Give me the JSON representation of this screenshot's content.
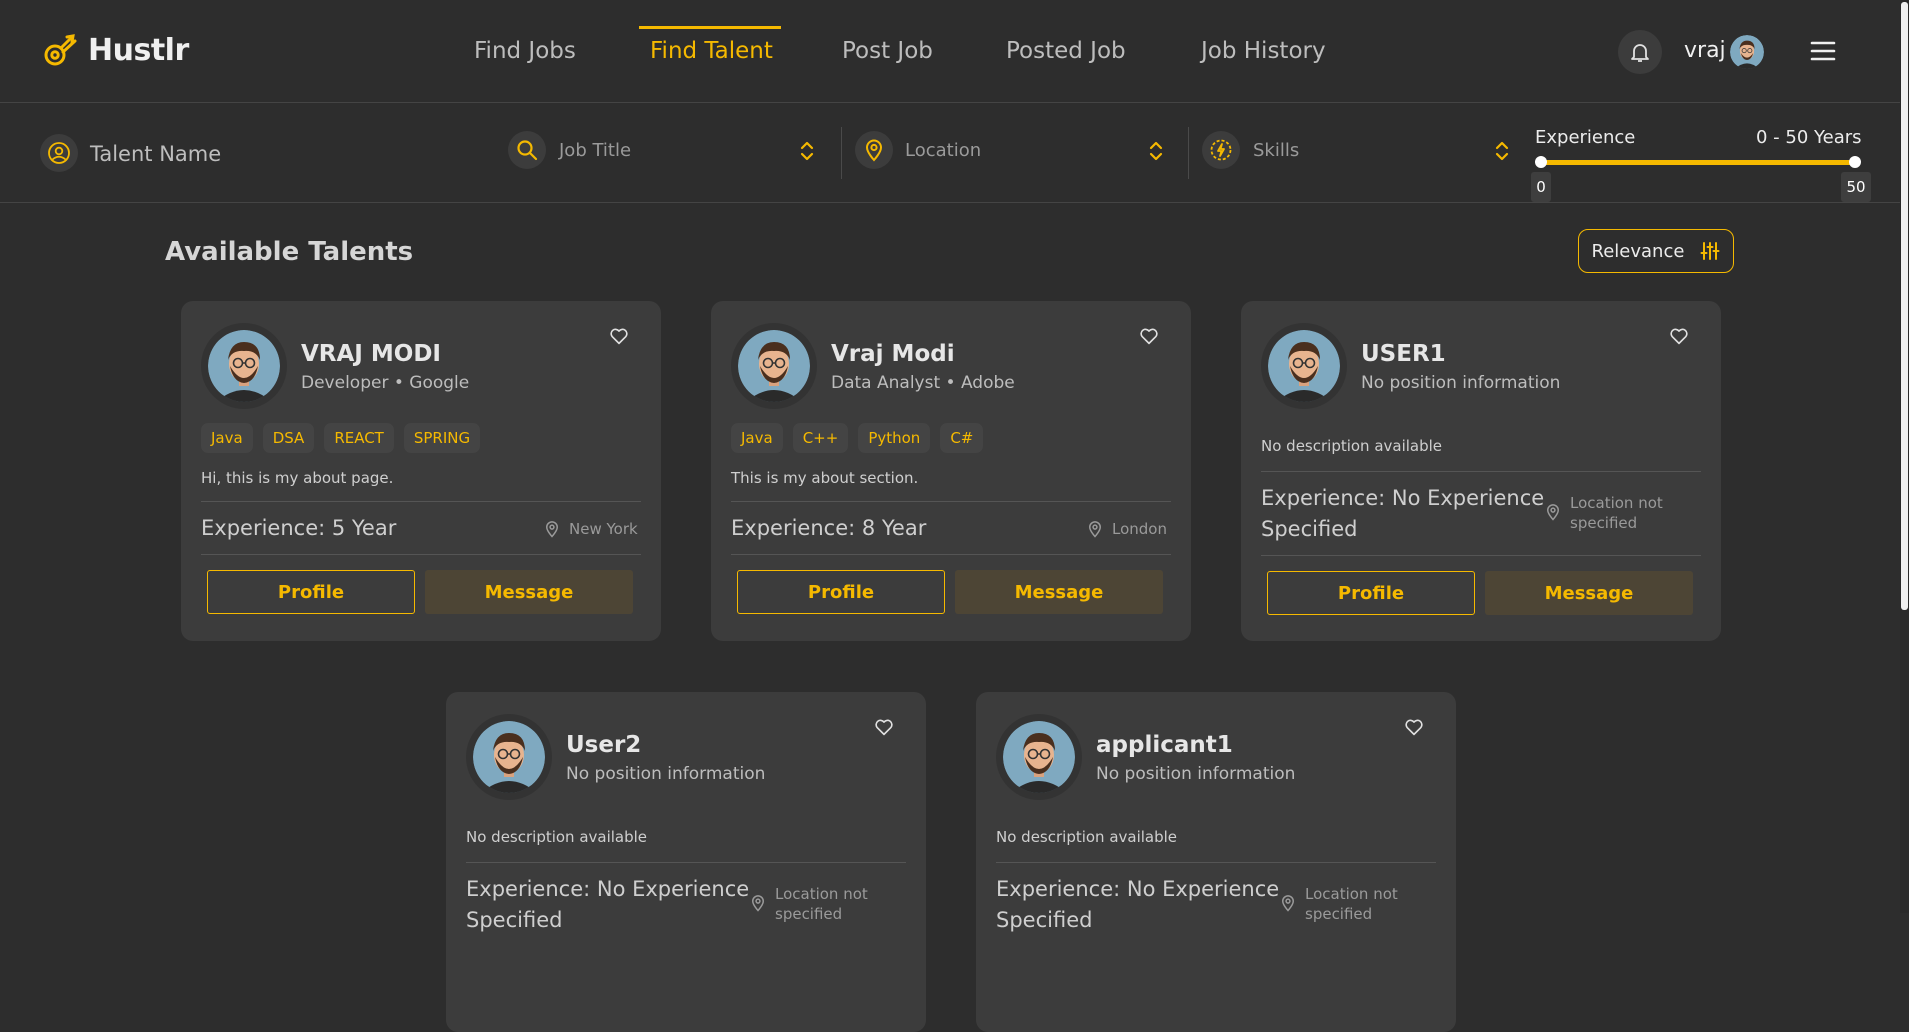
{
  "app": {
    "name": "Hustlr"
  },
  "nav": [
    {
      "label": "Find Jobs"
    },
    {
      "label": "Find Talent",
      "active": true
    },
    {
      "label": "Post Job"
    },
    {
      "label": "Posted Job"
    },
    {
      "label": "Job History"
    }
  ],
  "user": {
    "name": "vraj"
  },
  "filters": {
    "talent_name": "Talent Name",
    "job_title": "Job Title",
    "location": "Location",
    "skills": "Skills",
    "experience": {
      "label": "Experience",
      "range_text": "0 - 50 Years",
      "min": "0",
      "max": "50"
    }
  },
  "main": {
    "title": "Available Talents",
    "sort_label": "Relevance"
  },
  "buttons": {
    "profile": "Profile",
    "message": "Message"
  },
  "talents": [
    {
      "name": "VRAJ MODI",
      "position": "Developer • Google",
      "skills": [
        "Java",
        "DSA",
        "REACT",
        "SPRING"
      ],
      "about": "Hi, this is my about page.",
      "experience": "Experience: 5 Year",
      "location": "New York"
    },
    {
      "name": "Vraj Modi",
      "position": "Data Analyst • Adobe",
      "skills": [
        "Java",
        "C++",
        "Python",
        "C#"
      ],
      "about": "This is my about section.",
      "experience": "Experience: 8 Year",
      "location": "London"
    },
    {
      "name": "USER1",
      "position": "No position information",
      "skills": [],
      "about": "No description available",
      "experience": "Experience: No Experience Specified",
      "location": "Location not specified"
    },
    {
      "name": "User2",
      "position": "No position information",
      "skills": [],
      "about": "No description available",
      "experience": "Experience: No Experience Specified",
      "location": "Location not specified"
    },
    {
      "name": "applicant1",
      "position": "No position information",
      "skills": [],
      "about": "No description available",
      "experience": "Experience: No Experience Specified",
      "location": "Location not specified"
    }
  ],
  "colors": {
    "accent": "#f5b900",
    "background": "#2d2d2d",
    "card": "#3c3c3c"
  }
}
